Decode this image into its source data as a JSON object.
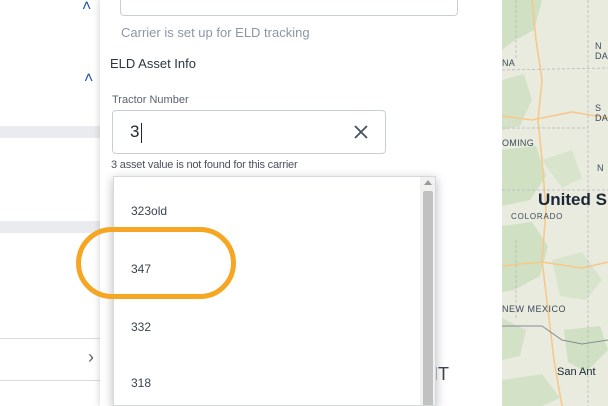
{
  "form": {
    "carrier_note": "Carrier is set up for ELD tracking",
    "section_title": "ELD Asset Info",
    "tractor": {
      "label": "Tractor Number",
      "value": "3",
      "error": "3 asset value is not found for this carrier"
    },
    "submit_fragment": "IT"
  },
  "dropdown": {
    "items": [
      {
        "label": "323old"
      },
      {
        "label": "347",
        "highlighted": true
      },
      {
        "label": "332"
      },
      {
        "label": "318"
      }
    ]
  },
  "map": {
    "labels": {
      "north_dakota": "N\nDA",
      "montana": "NA",
      "south_dakota": "S\nDA",
      "wyoming": "OMING",
      "nebraska": "N",
      "country": "United S",
      "colorado": "COLORADO",
      "new_mexico": "NEW MEXICO",
      "san_antonio": "San Ant"
    }
  },
  "colors": {
    "highlight": "#f5a623",
    "accent": "#24589c",
    "map_land": "#e9ebdf",
    "map_green": "#cfe0c3",
    "map_road": "#f6c98a"
  },
  "icons": {
    "clear": "close-icon",
    "collapse": "chevron-up-icon",
    "expand": "chevron-right-icon"
  }
}
